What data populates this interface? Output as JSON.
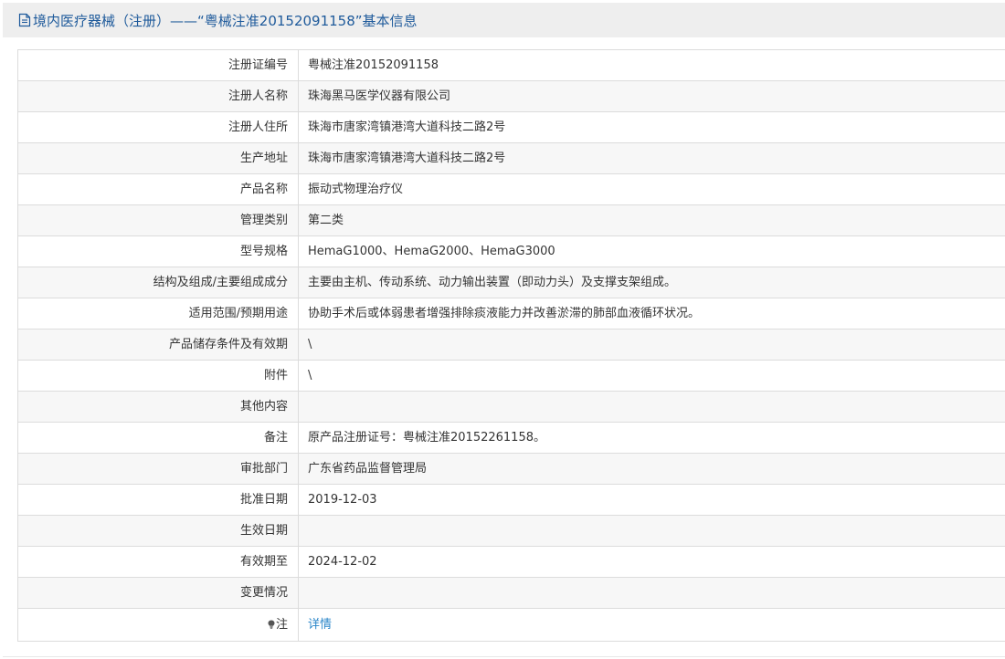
{
  "header": {
    "title": "境内医疗器械（注册）——“粤械注准20152091158”基本信息",
    "icon": "document-icon"
  },
  "rows": [
    {
      "label": "注册证编号",
      "value": "粤械注准20152091158"
    },
    {
      "label": "注册人名称",
      "value": "珠海黑马医学仪器有限公司"
    },
    {
      "label": "注册人住所",
      "value": "珠海市唐家湾镇港湾大道科技二路2号"
    },
    {
      "label": "生产地址",
      "value": "珠海市唐家湾镇港湾大道科技二路2号"
    },
    {
      "label": "产品名称",
      "value": "振动式物理治疗仪"
    },
    {
      "label": "管理类别",
      "value": "第二类"
    },
    {
      "label": "型号规格",
      "value": "HemaG1000、HemaG2000、HemaG3000"
    },
    {
      "label": "结构及组成/主要组成成分",
      "value": "主要由主机、传动系统、动力输出装置（即动力头）及支撑支架组成。"
    },
    {
      "label": "适用范围/预期用途",
      "value": "协助手术后或体弱患者增强排除痰液能力并改善淤滞的肺部血液循环状况。"
    },
    {
      "label": "产品储存条件及有效期",
      "value": "\\"
    },
    {
      "label": "附件",
      "value": "\\"
    },
    {
      "label": "其他内容",
      "value": ""
    },
    {
      "label": "备注",
      "value": "原产品注册证号：粤械注准20152261158。"
    },
    {
      "label": "审批部门",
      "value": "广东省药品监督管理局"
    },
    {
      "label": "批准日期",
      "value": "2019-12-03"
    },
    {
      "label": "生效日期",
      "value": ""
    },
    {
      "label": "有效期至",
      "value": "2024-12-02"
    },
    {
      "label": "变更情况",
      "value": ""
    }
  ],
  "note": {
    "label": "注",
    "icon": "lightbulb-icon",
    "link_text": "详情"
  },
  "colors": {
    "title": "#1e5a9b",
    "link": "#2a86c9",
    "row_alt": "#f7f7f7",
    "border": "#dcdcdc",
    "header_bg": "#eeeeee"
  }
}
